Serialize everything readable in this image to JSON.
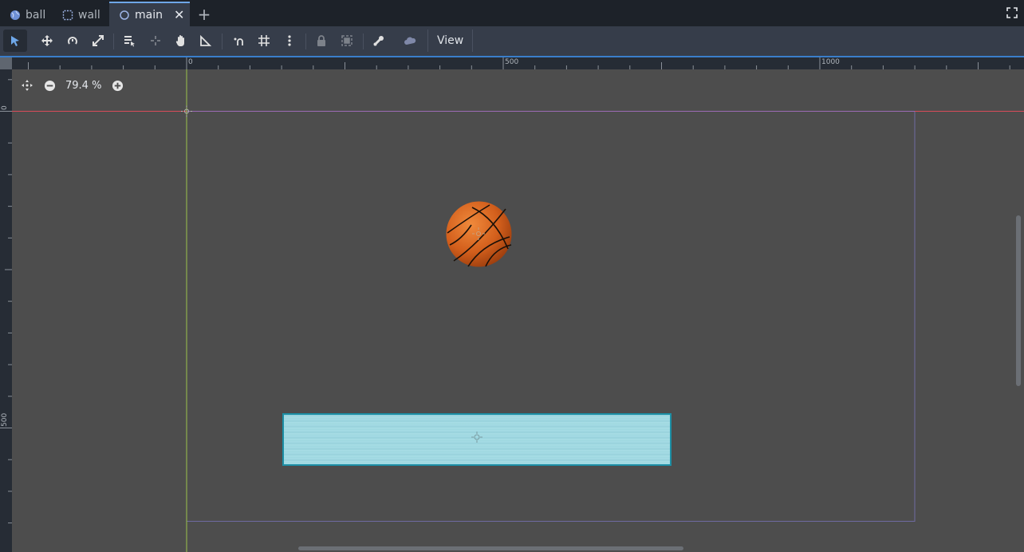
{
  "tabs": [
    {
      "label": "ball",
      "icon": "globe-icon",
      "active": false
    },
    {
      "label": "wall",
      "icon": "frame-icon",
      "active": false
    },
    {
      "label": "main",
      "icon": "circle-icon",
      "active": true
    }
  ],
  "toolbar": {
    "view_label": "View",
    "tools": [
      "select-icon",
      "move-icon",
      "rotate-icon",
      "scale-icon",
      "list-select-icon",
      "pivot-icon",
      "pan-icon",
      "ruler-icon",
      "smart-snap-icon",
      "grid-snap-icon",
      "more-icon",
      "lock-icon",
      "group-icon",
      "skeleton-icon",
      "cloud-icon"
    ]
  },
  "viewport": {
    "zoom_label": "79.4 %",
    "ruler_h_labels": [
      "0",
      "500",
      "1000"
    ],
    "ruler_v_labels": [
      "0",
      "500"
    ]
  },
  "colors": {
    "accent": "#3a7ecb",
    "canvas": "#4d4d4d",
    "wall": "#a6dde6",
    "ball": "#d9651f"
  }
}
